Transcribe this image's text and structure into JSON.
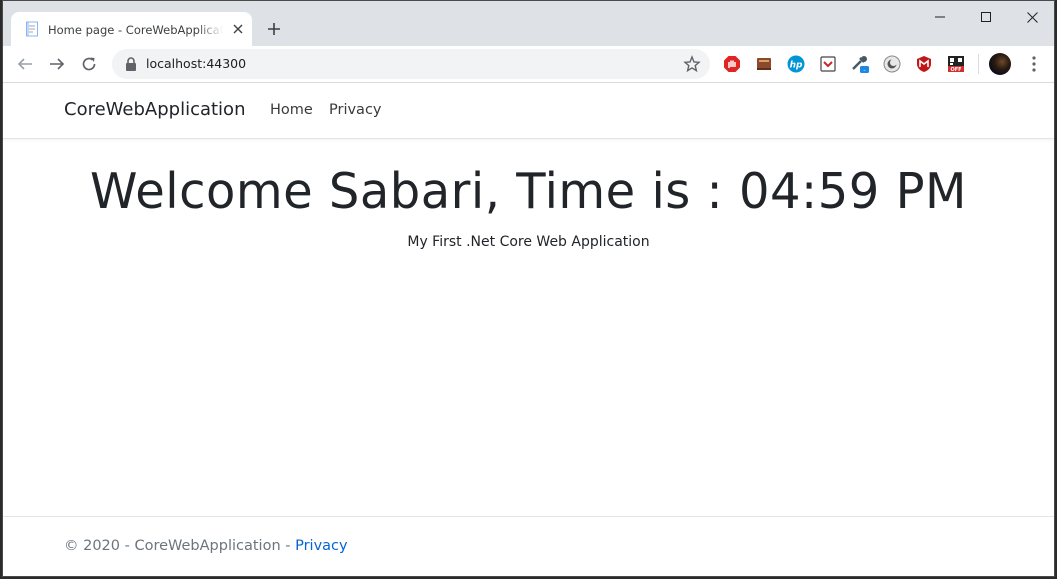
{
  "browser": {
    "tab": {
      "title": "Home page - CoreWebApplication",
      "favicon": "document-icon"
    },
    "url": "localhost:44300",
    "extensions": [
      "adblock-icon",
      "book-icon",
      "hp-icon",
      "pocket-icon",
      "eyedropper-icon",
      "dark-mode-icon",
      "mcafee-icon",
      "qr-off-icon"
    ],
    "extension_badge": "-"
  },
  "site": {
    "brand": "CoreWebApplication",
    "nav": {
      "home": "Home",
      "privacy": "Privacy"
    },
    "welcome": "Welcome Sabari, Time is : 04:59 PM",
    "subtitle": "My First .Net Core Web Application",
    "footer": {
      "copyright": "© 2020 - CoreWebApplication - ",
      "privacy_link": "Privacy"
    }
  },
  "colors": {
    "tabstrip": "#dee1e6",
    "link": "#0366d6",
    "footer_text": "#6c757d"
  }
}
